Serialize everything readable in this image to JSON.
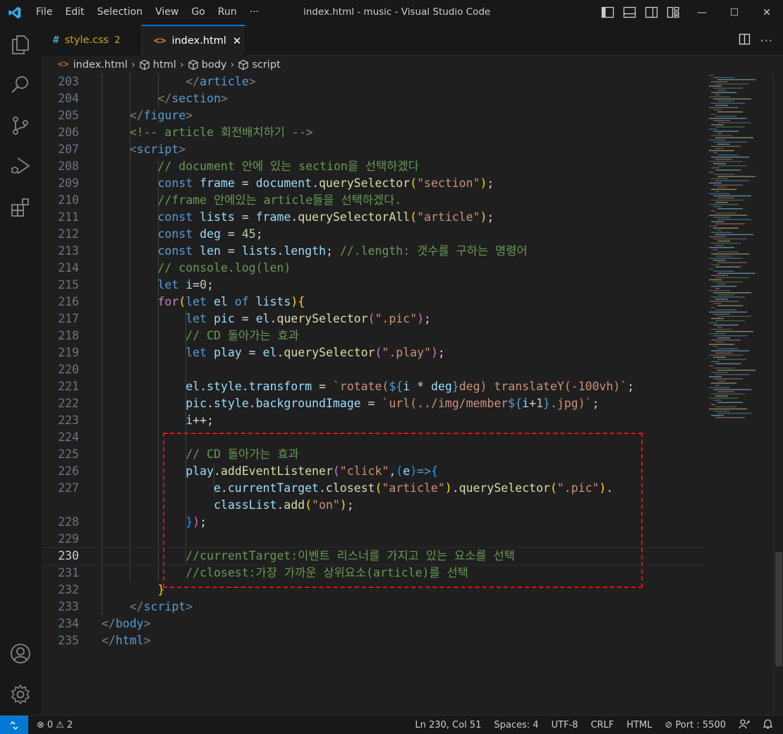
{
  "titlebar": {
    "menu": [
      "File",
      "Edit",
      "Selection",
      "View",
      "Go",
      "Run",
      "···"
    ],
    "title": "index.html - music - Visual Studio Code",
    "controls": {
      "minimize": "—",
      "maximize": "☐",
      "close": "✕"
    }
  },
  "activitybar": {
    "icons": [
      "explorer-icon",
      "search-icon",
      "source-control-icon",
      "run-debug-icon",
      "extensions-icon",
      "account-icon",
      "manage-gear-icon"
    ]
  },
  "tabs": [
    {
      "glyph": "#",
      "name": "style.css",
      "count": "2",
      "active": false
    },
    {
      "glyph": "<>",
      "name": "index.html",
      "close": "✕",
      "active": true
    }
  ],
  "breadcrumb": [
    "index.html",
    "html",
    "body",
    "script"
  ],
  "editor": {
    "lines": [
      {
        "n": "203",
        "html": "            <span class=\"t\">&lt;/</span><span class=\"tn\">article</span><span class=\"t\">&gt;</span>"
      },
      {
        "n": "204",
        "html": "        <span class=\"t\">&lt;/</span><span class=\"tn\">section</span><span class=\"t\">&gt;</span>"
      },
      {
        "n": "205",
        "html": "    <span class=\"t\">&lt;/</span><span class=\"tn\">figure</span><span class=\"t\">&gt;</span>"
      },
      {
        "n": "206",
        "html": "    <span class=\"cm\">&lt;!-- article 회전배치하기 --&gt;</span>"
      },
      {
        "n": "207",
        "html": "    <span class=\"t\">&lt;</span><span class=\"tn\">script</span><span class=\"t\">&gt;</span>"
      },
      {
        "n": "208",
        "html": "        <span class=\"cm\">// document 안에 있는 section을 선택하겠다</span>"
      },
      {
        "n": "209",
        "html": "        <span class=\"kw\">const</span> <span class=\"vr\">frame</span> <span class=\"op\">=</span> <span class=\"vr\">document</span><span class=\"op\">.</span><span class=\"fn\">querySelector</span><span class=\"pa\">(</span><span class=\"st\">\"section\"</span><span class=\"pa\">)</span><span class=\"op\">;</span>"
      },
      {
        "n": "210",
        "html": "        <span class=\"cm\">//frame 안에있는 article들을 선택하겠다.</span>"
      },
      {
        "n": "211",
        "html": "        <span class=\"kw\">const</span> <span class=\"vr\">lists</span> <span class=\"op\">=</span> <span class=\"vr\">frame</span><span class=\"op\">.</span><span class=\"fn\">querySelectorAll</span><span class=\"pa\">(</span><span class=\"st\">\"article\"</span><span class=\"pa\">)</span><span class=\"op\">;</span>"
      },
      {
        "n": "212",
        "html": "        <span class=\"kw\">const</span> <span class=\"vr\">deg</span> <span class=\"op\">=</span> <span class=\"nm\">45</span><span class=\"op\">;</span>"
      },
      {
        "n": "213",
        "html": "        <span class=\"kw\">const</span> <span class=\"vr\">len</span> <span class=\"op\">=</span> <span class=\"vr\">lists</span><span class=\"op\">.</span><span class=\"vr\">length</span><span class=\"op\">;</span> <span class=\"cm\">//.length: 갯수를 구하는 명령어</span>"
      },
      {
        "n": "214",
        "html": "        <span class=\"cm\">// console.log(len)</span>"
      },
      {
        "n": "215",
        "html": "        <span class=\"kw\">let</span> <span class=\"vr\">i</span><span class=\"op\">=</span><span class=\"nm\">0</span><span class=\"op\">;</span>"
      },
      {
        "n": "216",
        "html": "        <span class=\"cf\">for</span><span class=\"pa\">(</span><span class=\"kw\">let</span> <span class=\"vr\">el</span> <span class=\"kw\">of</span> <span class=\"vr\">lists</span><span class=\"pa\">)</span><span class=\"pa\">{</span>"
      },
      {
        "n": "217",
        "html": "            <span class=\"kw\">let</span> <span class=\"vr\">pic</span> <span class=\"op\">=</span> <span class=\"vr\">el</span><span class=\"op\">.</span><span class=\"fn\">querySelector</span><span class=\"pb\">(</span><span class=\"st\">\".pic\"</span><span class=\"pb\">)</span><span class=\"op\">;</span>"
      },
      {
        "n": "218",
        "html": "            <span class=\"cm\">// CD 돌아가는 효과</span>"
      },
      {
        "n": "219",
        "html": "            <span class=\"kw\">let</span> <span class=\"vr\">play</span> <span class=\"op\">=</span> <span class=\"vr\">el</span><span class=\"op\">.</span><span class=\"fn\">querySelector</span><span class=\"pb\">(</span><span class=\"st\">\".play\"</span><span class=\"pb\">)</span><span class=\"op\">;</span>"
      },
      {
        "n": "220",
        "html": ""
      },
      {
        "n": "221",
        "html": "            <span class=\"vr\">el</span><span class=\"op\">.</span><span class=\"vr\">style</span><span class=\"op\">.</span><span class=\"vr\">transform</span> <span class=\"op\">=</span> <span class=\"st\">`rotate(</span><span class=\"kw\">${</span><span class=\"vr\">i</span> <span class=\"op\">*</span> <span class=\"vr\">deg</span><span class=\"kw\">}</span><span class=\"st\">deg) translateY(-100vh)`</span><span class=\"op\">;</span>"
      },
      {
        "n": "222",
        "html": "            <span class=\"vr\">pic</span><span class=\"op\">.</span><span class=\"vr\">style</span><span class=\"op\">.</span><span class=\"vr\">backgroundImage</span> <span class=\"op\">=</span> <span class=\"st\">`url(../img/member</span><span class=\"kw\">${</span><span class=\"vr\">i</span><span class=\"op\">+</span><span class=\"nm\">1</span><span class=\"kw\">}</span><span class=\"st\">.jpg)`</span><span class=\"op\">;</span>"
      },
      {
        "n": "223",
        "html": "            <span class=\"vr\">i</span><span class=\"op\">++;</span>"
      },
      {
        "n": "224",
        "html": ""
      },
      {
        "n": "225",
        "html": "            <span class=\"cm\">// CD 돌아가는 효과</span>"
      },
      {
        "n": "226",
        "html": "            <span class=\"vr\">play</span><span class=\"op\">.</span><span class=\"fn\">addEventListener</span><span class=\"pb\">(</span><span class=\"st\">\"click\"</span><span class=\"op\">,</span><span class=\"pc\">(</span><span class=\"vr\">e</span><span class=\"pc\">)</span><span class=\"kw\">=&gt;</span><span class=\"pc\">{</span>"
      },
      {
        "n": "227",
        "html": "                <span class=\"vr\">e</span><span class=\"op\">.</span><span class=\"vr\">currentTarget</span><span class=\"op\">.</span><span class=\"fn\">closest</span><span class=\"pa\">(</span><span class=\"st\">\"article\"</span><span class=\"pa\">)</span><span class=\"op\">.</span><span class=\"fn\">querySelector</span><span class=\"pa\">(</span><span class=\"st\">\".pic\"</span><span class=\"pa\">)</span><span class=\"op\">.</span>"
      },
      {
        "n": "",
        "html": "                <span class=\"vr\">classList</span><span class=\"op\">.</span><span class=\"fn\">add</span><span class=\"pa\">(</span><span class=\"st\">\"on\"</span><span class=\"pa\">)</span><span class=\"op\">;</span>"
      },
      {
        "n": "228",
        "html": "            <span class=\"pc\">}</span><span class=\"pb\">)</span><span class=\"op\">;</span>"
      },
      {
        "n": "229",
        "html": ""
      },
      {
        "n": "230",
        "html": "            <span class=\"cm\">//currentTarget:이벤트 리스너를 가지고 있는 요소를 선택</span>",
        "current": true
      },
      {
        "n": "231",
        "html": "            <span class=\"cm\">//closest:가장 가까운 상위요소(article)를 선택</span>"
      },
      {
        "n": "232",
        "html": "        <span class=\"pa\">}</span>"
      },
      {
        "n": "233",
        "html": "    <span class=\"t\">&lt;/</span><span class=\"tn\">script</span><span class=\"t\">&gt;</span>"
      },
      {
        "n": "234",
        "html": "<span class=\"t\">&lt;/</span><span class=\"tn\">body</span><span class=\"t\">&gt;</span>"
      },
      {
        "n": "235",
        "html": "<span class=\"t\">&lt;/</span><span class=\"tn\">html</span><span class=\"t\">&gt;</span>"
      }
    ]
  },
  "statusbar": {
    "remote_icon": "remote-icon",
    "errors": "0",
    "warnings": "2",
    "position": "Ln 230, Col 51",
    "spaces": "Spaces: 4",
    "encoding": "UTF-8",
    "eol": "CRLF",
    "language": "HTML",
    "port": "Port : 5500"
  },
  "colors": {
    "accent": "#0078d4",
    "highlight_box": "#e81010",
    "editor_bg": "#1f1f1f"
  }
}
